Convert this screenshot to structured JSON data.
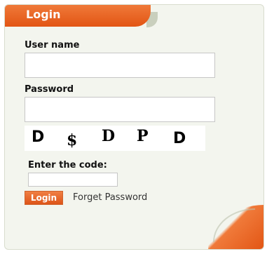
{
  "panel": {
    "title": "Login",
    "accent_color": "#e25514",
    "background_color": "#f3f5ee"
  },
  "form": {
    "username_label": "User name",
    "username_value": "",
    "password_label": "Password",
    "password_value": "",
    "captcha_chars": [
      "D",
      "$",
      "D",
      "P",
      "D"
    ],
    "code_label": "Enter the code:",
    "code_value": "",
    "login_label": "Login",
    "forget_password_label": "Forget Password"
  }
}
